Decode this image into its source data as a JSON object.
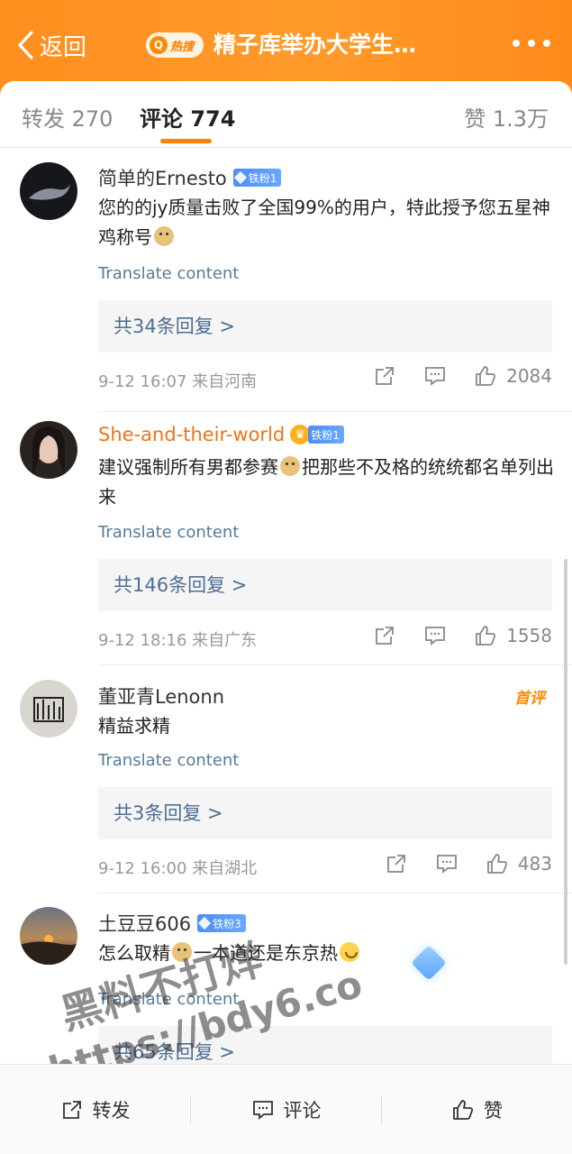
{
  "header": {
    "back_label": "返回",
    "hot_label": "热搜",
    "title": "精子库举办大学生…",
    "accent": "#ff8f1f"
  },
  "tabs": [
    {
      "label": "转发 270"
    },
    {
      "label": "评论 774"
    },
    {
      "label": "赞 1.3万"
    }
  ],
  "comments": [
    {
      "user": "简单的Ernesto",
      "fan_badge": "铁粉1",
      "text_a": "您的的jy质量击败了全国99%的用户，特此授予您五星神鸡称号",
      "translate": "Translate content",
      "replies": "共34条回复 >",
      "meta": "9-12 16:07  来自河南",
      "likes": "2084"
    },
    {
      "user": "She-and-their-world",
      "fan_badge": "铁粉1",
      "text_a": "建议强制所有男都参赛",
      "text_b": "把那些不及格的统统都名单列出来",
      "translate": "Translate content",
      "replies": "共146条回复 >",
      "meta": "9-12 18:16  来自广东",
      "likes": "1558"
    },
    {
      "user": "董亚青Lenonn",
      "tag": "首评",
      "text_a": "精益求精",
      "translate": "Translate content",
      "replies": "共3条回复 >",
      "meta": "9-12 16:00  来自湖北",
      "likes": "483"
    },
    {
      "user": "土豆豆606",
      "fan_badge": "铁粉3",
      "text_a": "怎么取精",
      "text_b": "一本道还是东京热",
      "translate": "Translate content",
      "replies": "共65条回复 >"
    }
  ],
  "bottom_bar": {
    "repost": "转发",
    "comment": "评论",
    "like": "赞"
  },
  "watermark": {
    "line1": "黑料不打烊",
    "line2": "https://bdy6.co"
  }
}
